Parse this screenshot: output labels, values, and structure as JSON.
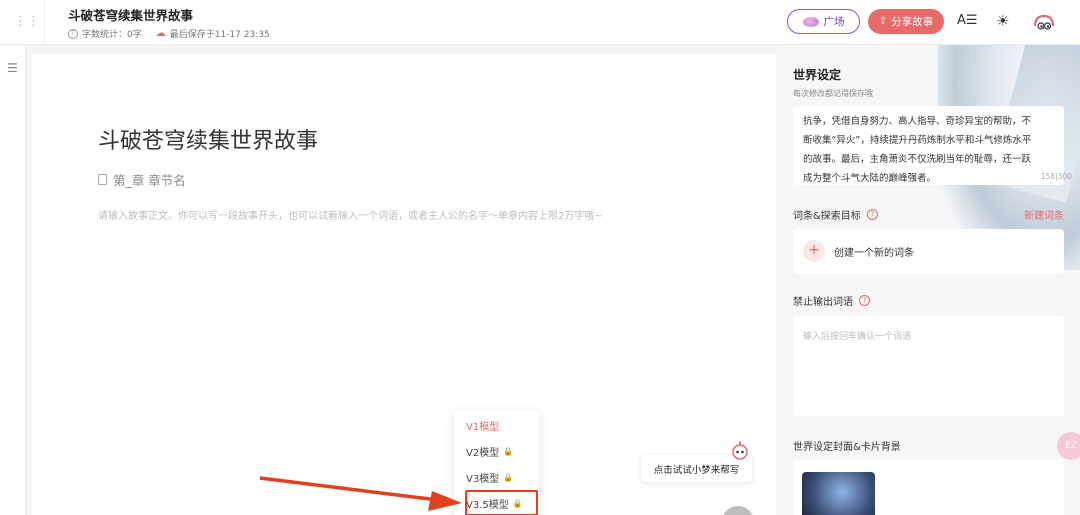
{
  "header": {
    "doc_title": "斗破苍穹续集世界故事",
    "word_count": "字数统计：0字",
    "last_saved": "最后保存于11-17 23:35",
    "plaza_label": "广场",
    "share_label": "分享故事",
    "font_icon_text": "A☰"
  },
  "editor": {
    "title": "斗破苍穹续集世界故事",
    "chapter_placeholder": "第_章 章节名",
    "body_placeholder": "请输入故事正文。你可以写一段故事开头，也可以试着输入一个词语，或者主人公的名字～单章内容上限2万字哦~"
  },
  "model_menu": {
    "items": [
      {
        "label": "V1模型",
        "locked": false,
        "active": true
      },
      {
        "label": "V2模型",
        "locked": true,
        "active": false
      },
      {
        "label": "V3模型",
        "locked": true,
        "active": false
      },
      {
        "label": "V3.5模型",
        "locked": true,
        "active": false
      }
    ]
  },
  "helper": {
    "text": "点击试试小梦来帮写"
  },
  "right_panel": {
    "world_title": "世界设定",
    "world_sub": "每次修改都记得保存哦",
    "world_text_lines": [
      "抗争，凭借自身努力、高人指导、奇珍异宝的帮助，不",
      "断收集“异火”，持续提升丹药炼制水平和斗气修炼水平",
      "的故事。最后，主角萧炎不仅洗刷当年的耻辱，还一跃",
      "成为整个斗气大陆的巅峰强者。"
    ],
    "world_count": "158|300",
    "entry_section": "词条&探索目标",
    "new_entry": "新建词条",
    "create_entry": "创建一个新的词条",
    "ban_section": "禁止输出词语",
    "ban_placeholder": "输入后按回车确认一个词语",
    "cover_section": "世界设定封面&卡片背景",
    "float_label": "EZ"
  },
  "colors": {
    "accent": "#e86b6b",
    "plaza_border": "#8a4fd6",
    "highlight_box": "#e0401f"
  }
}
